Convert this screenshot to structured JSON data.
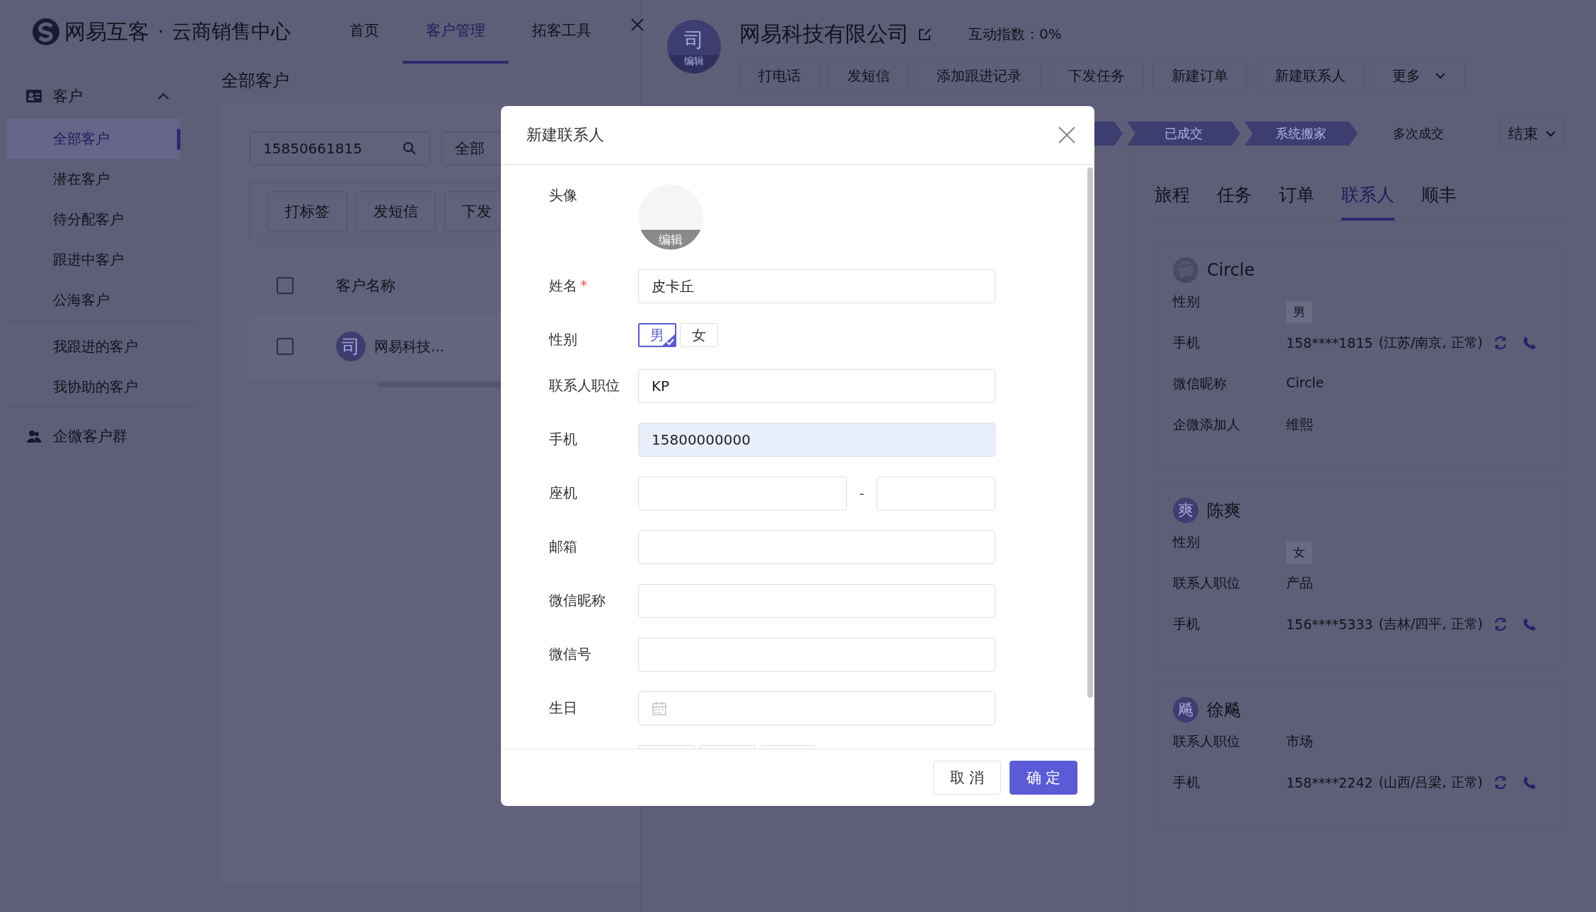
{
  "header": {
    "brand": "网易互客",
    "separator": "·",
    "product": "云商销售中心",
    "nav": [
      {
        "label": "首页",
        "selected": false
      },
      {
        "label": "客户管理",
        "selected": true
      },
      {
        "label": "拓客工具",
        "selected": false
      }
    ]
  },
  "sidebar": {
    "groups": [
      {
        "label": "客户",
        "expanded": true,
        "sections": [
          {
            "items": [
              {
                "label": "全部客户",
                "selected": true
              },
              {
                "label": "潜在客户",
                "selected": false
              },
              {
                "label": "待分配客户",
                "selected": false
              },
              {
                "label": "跟进中客户",
                "selected": false
              },
              {
                "label": "公海客户",
                "selected": false
              }
            ]
          },
          {
            "items": [
              {
                "label": "我跟进的客户",
                "selected": false
              },
              {
                "label": "我协助的客户",
                "selected": false
              }
            ]
          }
        ]
      },
      {
        "label": "企微客户群"
      }
    ]
  },
  "main": {
    "title": "全部客户",
    "search": {
      "value": "15850661815"
    },
    "filter": {
      "value": "全部"
    },
    "toolbar": [
      "打标签",
      "发短信",
      "下发"
    ],
    "table": {
      "columns": [
        "客户名称"
      ],
      "select_all_checked": false,
      "rows": [
        {
          "avatar": "司",
          "name": "网易科技...",
          "checked": false
        }
      ]
    }
  },
  "drawer": {
    "avatar": "司",
    "avatar_caption": "编辑",
    "company": "网易科技有限公司",
    "score": "互动指数：0%",
    "actions": [
      {
        "label": "打电话",
        "kind": "button"
      },
      {
        "label": "发短信",
        "kind": "button"
      },
      {
        "label": "添加跟进记录",
        "kind": "button"
      },
      {
        "label": "下发任务",
        "kind": "button"
      },
      {
        "label": "新建订单",
        "kind": "button"
      },
      {
        "label": "新建联系人",
        "kind": "button"
      },
      {
        "label": "更多",
        "kind": "dropdown"
      }
    ],
    "stages": [
      {
        "label": "已成交",
        "reached": true
      },
      {
        "label": "系统搬家",
        "reached": true
      },
      {
        "label": "多次成交",
        "reached": false
      }
    ],
    "stage_end": "结束",
    "tabs": [
      {
        "label": "旅程",
        "selected": false
      },
      {
        "label": "任务",
        "selected": false
      },
      {
        "label": "订单",
        "selected": false
      },
      {
        "label": "联系人",
        "selected": true
      },
      {
        "label": "顺丰",
        "selected": false
      }
    ],
    "contacts": [
      {
        "name": "Circle",
        "avatar": {
          "kind": "picture"
        },
        "fields": [
          {
            "label": "性别",
            "kind": "tag",
            "value": "男"
          },
          {
            "label": "手机",
            "kind": "phone",
            "value": "158****1815",
            "location": "(江苏/南京, 正常)"
          },
          {
            "label": "微信昵称",
            "kind": "text",
            "value": "Circle"
          },
          {
            "label": "企微添加人",
            "kind": "text",
            "value": "维熙"
          }
        ]
      },
      {
        "name": "陈爽",
        "avatar": {
          "kind": "initial",
          "text": "爽"
        },
        "fields": [
          {
            "label": "性别",
            "kind": "tag",
            "value": "女"
          },
          {
            "label": "联系人职位",
            "kind": "text",
            "value": "产品"
          },
          {
            "label": "手机",
            "kind": "phone",
            "value": "156****5333",
            "location": "(吉林/四平, 正常)"
          }
        ]
      },
      {
        "name": "徐飚",
        "avatar": {
          "kind": "initial",
          "text": "飚"
        },
        "fields": [
          {
            "label": "联系人职位",
            "kind": "text",
            "value": "市场"
          },
          {
            "label": "手机",
            "kind": "phone",
            "value": "158****2242",
            "location": "(山西/吕梁, 正常)"
          }
        ]
      }
    ]
  },
  "modal": {
    "title": "新建联系人",
    "fields": [
      {
        "kind": "avatar",
        "label": "头像",
        "caption": "编辑"
      },
      {
        "kind": "text",
        "label": "姓名",
        "required_mark": "*",
        "value": "皮卡丘"
      },
      {
        "kind": "choice",
        "label": "性别",
        "options": [
          {
            "label": "男",
            "selected": true
          },
          {
            "label": "女",
            "selected": false
          }
        ]
      },
      {
        "kind": "text",
        "label": "联系人职位",
        "value": "KP"
      },
      {
        "kind": "text",
        "label": "手机",
        "value": "15800000000",
        "autofilled": true
      },
      {
        "kind": "pair",
        "label": "座机",
        "separator": "-"
      },
      {
        "kind": "text",
        "label": "邮箱"
      },
      {
        "kind": "text",
        "label": "微信昵称"
      },
      {
        "kind": "text",
        "label": "微信号"
      },
      {
        "kind": "date",
        "label": "生日"
      },
      {
        "kind": "clipped-choice"
      }
    ],
    "buttons": [
      {
        "label": "取 消",
        "primary": false
      },
      {
        "label": "确 定",
        "primary": true
      }
    ]
  }
}
